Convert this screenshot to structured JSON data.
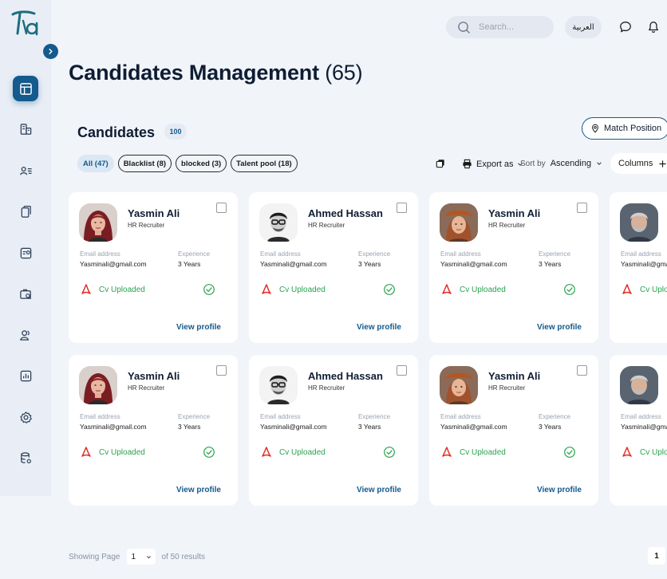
{
  "topbar": {
    "search_placeholder": "Search...",
    "language_label": "العربية"
  },
  "page": {
    "title": "Candidates Management",
    "count": "(65)"
  },
  "section": {
    "title": "Candidates",
    "badge": "100",
    "match_label": "Match Position"
  },
  "filters": [
    {
      "label": "All (47)",
      "active": true
    },
    {
      "label": "Blacklist (8)",
      "active": false
    },
    {
      "label": "blocked (3)",
      "active": false
    },
    {
      "label": "Talent pool (18)",
      "active": false
    }
  ],
  "toolbar": {
    "export_label": "Export as",
    "sort_label": "Sort by",
    "sort_value": "Ascending",
    "columns_label": "Columns"
  },
  "cards": [
    {
      "name": "Yasmin Ali",
      "role": "HR Recruiter",
      "email_label": "Email address",
      "email": "Yasminali@gmail.com",
      "exp_label": "Experience",
      "exp": "3 Years",
      "cv_status": "Cv Uploaded",
      "action": "View profile",
      "avatar": "woman-red"
    },
    {
      "name": "Ahmed Hassan",
      "role": "HR Recruiter",
      "email_label": "Email address",
      "email": "Yasminali@gmail.com",
      "exp_label": "Experience",
      "exp": "3 Years",
      "cv_status": "Cv Uploaded",
      "action": "View profile",
      "avatar": "man-glasses"
    },
    {
      "name": "Yasmin Ali",
      "role": "HR Recruiter",
      "email_label": "Email address",
      "email": "Yasminali@gmail.com",
      "exp_label": "Experience",
      "exp": "3 Years",
      "cv_status": "Cv Uploaded",
      "action": "View profile",
      "avatar": "woman-hat"
    },
    {
      "name": "",
      "role": "",
      "email_label": "Email address",
      "email": "Yasminali@gmail.com",
      "exp_label": "",
      "exp": "",
      "cv_status": "Cv Uploaded",
      "action": "",
      "avatar": "man-gray"
    },
    {
      "name": "Yasmin Ali",
      "role": "HR Recruiter",
      "email_label": "Email address",
      "email": "Yasminali@gmail.com",
      "exp_label": "Experience",
      "exp": "3 Years",
      "cv_status": "Cv Uploaded",
      "action": "View profile",
      "avatar": "woman-red"
    },
    {
      "name": "Ahmed Hassan",
      "role": "HR Recruiter",
      "email_label": "Email address",
      "email": "Yasminali@gmail.com",
      "exp_label": "Experience",
      "exp": "3 Years",
      "cv_status": "Cv Uploaded",
      "action": "View profile",
      "avatar": "man-glasses"
    },
    {
      "name": "Yasmin Ali",
      "role": "HR Recruiter",
      "email_label": "Email address",
      "email": "Yasminali@gmail.com",
      "exp_label": "Experience",
      "exp": "3 Years",
      "cv_status": "Cv Uploaded",
      "action": "View profile",
      "avatar": "woman-hat"
    },
    {
      "name": "",
      "role": "",
      "email_label": "Email address",
      "email": "Yasminali@gmail.com",
      "exp_label": "",
      "exp": "",
      "cv_status": "Cv Uploaded",
      "action": "",
      "avatar": "man-gray"
    }
  ],
  "pagination": {
    "showing_label": "Showing Page",
    "current_page": "1",
    "results_label": "of 50 results",
    "page_button": "1"
  },
  "colors": {
    "primary": "#145a8c",
    "success": "#29a34f",
    "pdf": "#e0302b"
  },
  "icons": {
    "sidebar": [
      "dashboard-icon",
      "org-chart-icon",
      "candidates-list-icon",
      "documents-icon",
      "assessment-icon",
      "job-search-icon",
      "users-icon",
      "reports-icon",
      "settings-icon",
      "database-icon"
    ]
  }
}
